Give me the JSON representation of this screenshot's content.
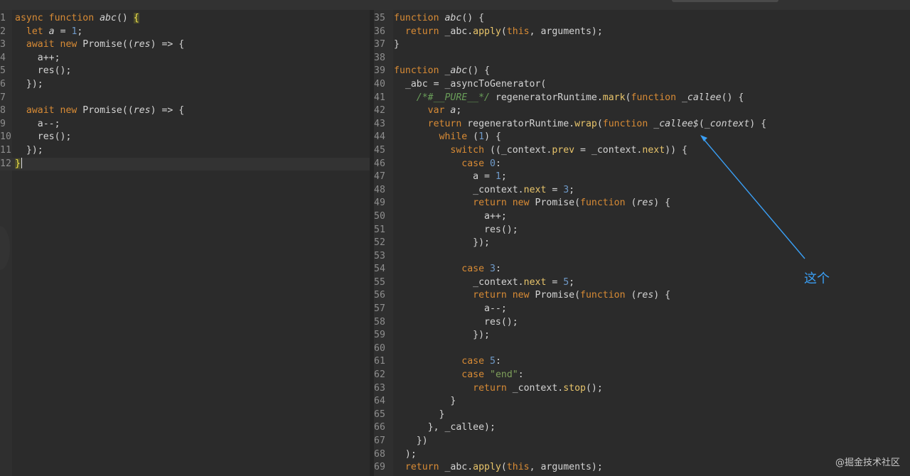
{
  "left_editor": {
    "lines": [
      {
        "n": "1",
        "html": "<span class=\"kw\">async function</span> <span class=\"it\">abc</span>() <span class=\"br\">{</span>"
      },
      {
        "n": "2",
        "html": "  <span class=\"kw\">let</span> <span class=\"it\">a</span> = <span class=\"num\">1</span>;"
      },
      {
        "n": "3",
        "html": "  <span class=\"kw\">await new</span> Promise((<span class=\"it\">res</span>) => {"
      },
      {
        "n": "4",
        "html": "    a++;"
      },
      {
        "n": "5",
        "html": "    res();"
      },
      {
        "n": "6",
        "html": "  });"
      },
      {
        "n": "7",
        "html": ""
      },
      {
        "n": "8",
        "html": "  <span class=\"kw\">await new</span> Promise((<span class=\"it\">res</span>) => {"
      },
      {
        "n": "9",
        "html": "    a--;"
      },
      {
        "n": "10",
        "html": "    res();"
      },
      {
        "n": "11",
        "html": "  });"
      },
      {
        "n": "12",
        "html": "<span class=\"br\">}</span><span class=\"caret\"></span>"
      }
    ]
  },
  "right_editor": {
    "lines": [
      {
        "n": "35",
        "html": "<span class=\"kw\">function</span> <span class=\"it\">abc</span>() {"
      },
      {
        "n": "36",
        "html": "  <span class=\"kw\">return</span> _abc.<span class=\"fn\">apply</span>(<span class=\"kw\">this</span>, arguments);"
      },
      {
        "n": "37",
        "html": "}"
      },
      {
        "n": "38",
        "html": ""
      },
      {
        "n": "39",
        "html": "<span class=\"kw\">function</span> <span class=\"it\">_abc</span>() {"
      },
      {
        "n": "40",
        "html": "  _abc = _asyncToGenerator("
      },
      {
        "n": "41",
        "html": "    <span class=\"cm\">/*#__PURE__*/</span> regeneratorRuntime.<span class=\"fn\">mark</span>(<span class=\"kw\">function</span> <span class=\"it\">_callee</span>() {"
      },
      {
        "n": "42",
        "html": "      <span class=\"kw\">var</span> <span class=\"it\">a</span>;"
      },
      {
        "n": "43",
        "html": "      <span class=\"kw\">return</span> regeneratorRuntime.<span class=\"fn\">wrap</span>(<span class=\"kw\">function</span> <span class=\"it\">_callee$</span>(<span class=\"it\">_context</span>) {"
      },
      {
        "n": "44",
        "html": "        <span class=\"kw\">while</span> (<span class=\"num\">1</span>) {"
      },
      {
        "n": "45",
        "html": "          <span class=\"kw\">switch</span> ((_context.<span class=\"fn\">prev</span> = _context.<span class=\"fn\">next</span>)) {"
      },
      {
        "n": "46",
        "html": "            <span class=\"kw\">case</span> <span class=\"num\">0</span>:"
      },
      {
        "n": "47",
        "html": "              a = <span class=\"num\">1</span>;"
      },
      {
        "n": "48",
        "html": "              _context.<span class=\"fn\">next</span> = <span class=\"num\">3</span>;"
      },
      {
        "n": "49",
        "html": "              <span class=\"kw\">return new</span> Promise(<span class=\"kw\">function</span> (<span class=\"it\">res</span>) {"
      },
      {
        "n": "50",
        "html": "                a++;"
      },
      {
        "n": "51",
        "html": "                res();"
      },
      {
        "n": "52",
        "html": "              });"
      },
      {
        "n": "53",
        "html": ""
      },
      {
        "n": "54",
        "html": "            <span class=\"kw\">case</span> <span class=\"num\">3</span>:"
      },
      {
        "n": "55",
        "html": "              _context.<span class=\"fn\">next</span> = <span class=\"num\">5</span>;"
      },
      {
        "n": "56",
        "html": "              <span class=\"kw\">return new</span> Promise(<span class=\"kw\">function</span> (<span class=\"it\">res</span>) {"
      },
      {
        "n": "57",
        "html": "                a--;"
      },
      {
        "n": "58",
        "html": "                res();"
      },
      {
        "n": "59",
        "html": "              });"
      },
      {
        "n": "60",
        "html": ""
      },
      {
        "n": "61",
        "html": "            <span class=\"kw\">case</span> <span class=\"num\">5</span>:"
      },
      {
        "n": "62",
        "html": "            <span class=\"kw\">case</span> <span class=\"str\">\"end\"</span>:"
      },
      {
        "n": "63",
        "html": "              <span class=\"kw\">return</span> _context.<span class=\"fn\">stop</span>();"
      },
      {
        "n": "64",
        "html": "          }"
      },
      {
        "n": "65",
        "html": "        }"
      },
      {
        "n": "66",
        "html": "      }, _callee);"
      },
      {
        "n": "67",
        "html": "    })"
      },
      {
        "n": "68",
        "html": "  );"
      },
      {
        "n": "69",
        "html": "  <span class=\"kw\">return</span> _abc.<span class=\"fn\">apply</span>(<span class=\"kw\">this</span>, arguments);"
      }
    ]
  },
  "annotation": {
    "label": "这个",
    "color": "#3a9ff5"
  },
  "watermark": "@掘金技术社区"
}
